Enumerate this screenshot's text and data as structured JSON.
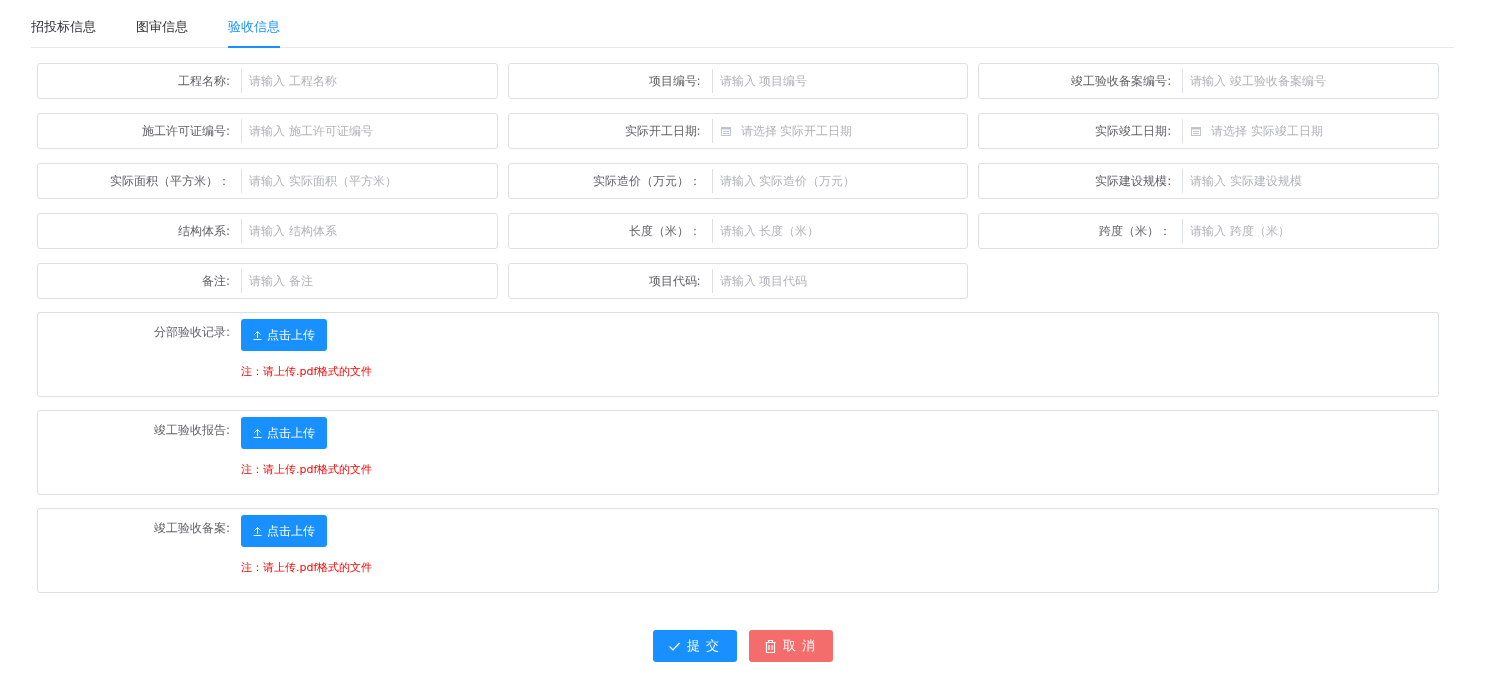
{
  "tabs": [
    {
      "label": "招投标信息",
      "selected": false
    },
    {
      "label": "图审信息",
      "selected": false
    },
    {
      "label": "验收信息",
      "selected": true
    }
  ],
  "fields": [
    {
      "kind": "text",
      "label": "工程名称:",
      "placeholder": "请输入 工程名称"
    },
    {
      "kind": "text",
      "label": "项目编号:",
      "placeholder": "请输入 项目编号"
    },
    {
      "kind": "text",
      "label": "竣工验收备案编号:",
      "placeholder": "请输入 竣工验收备案编号"
    },
    {
      "kind": "text",
      "label": "施工许可证编号:",
      "placeholder": "请输入 施工许可证编号"
    },
    {
      "kind": "date",
      "label": "实际开工日期:",
      "placeholder": "请选择 实际开工日期"
    },
    {
      "kind": "date",
      "label": "实际竣工日期:",
      "placeholder": "请选择 实际竣工日期"
    },
    {
      "kind": "text",
      "label": "实际面积（平方米）：",
      "placeholder": "请输入 实际面积（平方米）"
    },
    {
      "kind": "text",
      "label": "实际造价（万元）：",
      "placeholder": "请输入 实际造价（万元）"
    },
    {
      "kind": "text",
      "label": "实际建设规模:",
      "placeholder": "请输入 实际建设规模"
    },
    {
      "kind": "text",
      "label": "结构体系:",
      "placeholder": "请输入 结构体系"
    },
    {
      "kind": "text",
      "label": "长度（米）：",
      "placeholder": "请输入 长度（米）"
    },
    {
      "kind": "text",
      "label": "跨度（米）：",
      "placeholder": "请输入 跨度（米）"
    },
    {
      "kind": "text",
      "label": "备注:",
      "placeholder": "请输入 备注"
    },
    {
      "kind": "text",
      "label": "项目代码:",
      "placeholder": "请输入 项目代码"
    }
  ],
  "uploads": [
    {
      "label": "分部验收记录:",
      "button": "点击上传",
      "note": "注：请上传.pdf格式的文件"
    },
    {
      "label": "竣工验收报告:",
      "button": "点击上传",
      "note": "注：请上传.pdf格式的文件"
    },
    {
      "label": "竣工验收备案:",
      "button": "点击上传",
      "note": "注：请上传.pdf格式的文件"
    }
  ],
  "actions": [
    {
      "kind": "submit",
      "label": "提 交"
    },
    {
      "kind": "cancel",
      "label": "取 消"
    }
  ]
}
